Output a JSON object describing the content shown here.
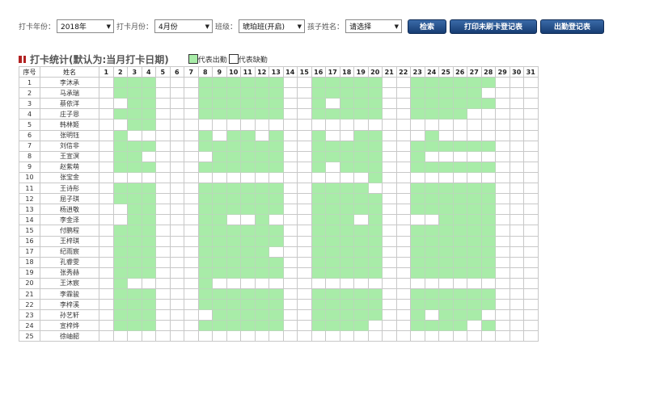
{
  "toolbar": {
    "year_label": "打卡年份：",
    "year_value": "2018年",
    "month_label": "打卡月份：",
    "month_value": "4月份",
    "class_label": "班级：",
    "class_value": "琥珀班(开启)",
    "child_label": "孩子姓名：",
    "child_value": "请选择",
    "search_label": "检索",
    "print_unswiped_label": "打印未刷卡登记表",
    "attendance_register_label": "出勤登记表"
  },
  "section": {
    "title": "打卡统计(默认为:当月打卡日期)",
    "legend_present": "代表出勤",
    "legend_absent": "代表缺勤"
  },
  "colors": {
    "present": "#a8eca8",
    "button": "#1f4a85",
    "title_marker": "#b22222"
  },
  "table": {
    "headers": {
      "index": "序号",
      "name": "姓名"
    },
    "days": [
      "1",
      "2",
      "3",
      "4",
      "5",
      "6",
      "7",
      "8",
      "9",
      "10",
      "11",
      "12",
      "13",
      "14",
      "15",
      "16",
      "17",
      "18",
      "19",
      "20",
      "21",
      "22",
      "23",
      "24",
      "25",
      "26",
      "27",
      "28",
      "29",
      "30",
      "31"
    ],
    "rows": [
      {
        "index": "1",
        "name": "李沐承",
        "present": [
          2,
          3,
          4,
          8,
          9,
          10,
          11,
          12,
          13,
          16,
          17,
          18,
          19,
          20,
          23,
          24,
          25,
          26,
          27,
          28
        ]
      },
      {
        "index": "2",
        "name": "马承瑞",
        "present": [
          2,
          3,
          4,
          8,
          9,
          10,
          11,
          12,
          13,
          16,
          17,
          18,
          19,
          20,
          23,
          24,
          25,
          26,
          27
        ]
      },
      {
        "index": "3",
        "name": "蔡依洋",
        "present": [
          3,
          4,
          8,
          9,
          10,
          11,
          12,
          13,
          16,
          18,
          19,
          20,
          23,
          24,
          25,
          26,
          27,
          28
        ]
      },
      {
        "index": "4",
        "name": "庄子恩",
        "present": [
          2,
          3,
          4,
          8,
          9,
          10,
          11,
          12,
          13,
          16,
          17,
          18,
          19,
          20,
          23,
          24,
          25,
          26
        ]
      },
      {
        "index": "5",
        "name": "韩林姬",
        "present": [
          3,
          4
        ]
      },
      {
        "index": "6",
        "name": "张明钰",
        "present": [
          2,
          8,
          10,
          11,
          13,
          16,
          19,
          20,
          24
        ]
      },
      {
        "index": "7",
        "name": "刘信非",
        "present": [
          2,
          3,
          4,
          8,
          9,
          10,
          11,
          12,
          13,
          16,
          17,
          18,
          19,
          20,
          23,
          24,
          25,
          26,
          27,
          28
        ]
      },
      {
        "index": "8",
        "name": "王宣溟",
        "present": [
          2,
          3,
          9,
          10,
          11,
          12,
          13,
          16,
          17,
          18,
          19,
          20,
          23
        ]
      },
      {
        "index": "9",
        "name": "赵紫萌",
        "present": [
          2,
          3,
          4,
          8,
          9,
          10,
          11,
          12,
          13,
          16,
          18,
          19,
          20,
          23,
          24,
          25,
          26,
          27,
          28
        ]
      },
      {
        "index": "10",
        "name": "张宝金",
        "present": [
          20
        ]
      },
      {
        "index": "11",
        "name": "王诗彤",
        "present": [
          2,
          3,
          4,
          8,
          9,
          10,
          11,
          12,
          13,
          16,
          17,
          18,
          19,
          23,
          24,
          25,
          26,
          27,
          28
        ]
      },
      {
        "index": "12",
        "name": "屈子琪",
        "present": [
          2,
          3,
          4,
          8,
          9,
          10,
          11,
          12,
          13,
          16,
          17,
          18,
          19,
          20,
          23,
          24,
          25,
          26,
          27,
          28
        ]
      },
      {
        "index": "13",
        "name": "杨逍敬",
        "present": [
          3,
          4,
          8,
          9,
          10,
          11,
          12,
          13,
          16,
          17,
          18,
          19,
          20,
          23,
          24,
          25,
          26,
          27,
          28
        ]
      },
      {
        "index": "14",
        "name": "李金泽",
        "present": [
          3,
          4,
          8,
          9,
          12,
          16,
          17,
          18,
          20,
          25,
          26,
          27,
          28
        ]
      },
      {
        "index": "15",
        "name": "付鹏程",
        "present": [
          2,
          3,
          4,
          8,
          9,
          10,
          11,
          12,
          13,
          16,
          17,
          18,
          19,
          20,
          23,
          24,
          25,
          26,
          27,
          28
        ]
      },
      {
        "index": "16",
        "name": "王梓琪",
        "present": [
          2,
          3,
          4,
          8,
          9,
          10,
          11,
          12,
          13,
          16,
          17,
          18,
          19,
          20,
          23,
          24,
          25,
          26,
          27,
          28
        ]
      },
      {
        "index": "17",
        "name": "纪雨宸",
        "present": [
          2,
          3,
          4,
          8,
          9,
          10,
          11,
          12,
          16,
          17,
          18,
          19,
          20,
          23,
          24,
          25,
          26,
          27,
          28
        ]
      },
      {
        "index": "18",
        "name": "孔睿雯",
        "present": [
          2,
          3,
          4,
          8,
          9,
          10,
          11,
          12,
          13,
          16,
          17,
          18,
          19,
          20,
          23,
          24,
          25,
          26,
          27,
          28
        ]
      },
      {
        "index": "19",
        "name": "张秀赫",
        "present": [
          2,
          3,
          4,
          8,
          9,
          10,
          11,
          12,
          13,
          16,
          17,
          18,
          19,
          20,
          23,
          24,
          25,
          26,
          27,
          28
        ]
      },
      {
        "index": "20",
        "name": "王沐宸",
        "present": [
          2,
          8
        ]
      },
      {
        "index": "21",
        "name": "李霖骏",
        "present": [
          2,
          3,
          4,
          8,
          9,
          10,
          11,
          12,
          13,
          16,
          17,
          18,
          19,
          20,
          23,
          24,
          25,
          26,
          27,
          28
        ]
      },
      {
        "index": "22",
        "name": "李梓溪",
        "present": [
          2,
          3,
          4,
          8,
          9,
          10,
          11,
          12,
          13,
          16,
          17,
          18,
          19,
          20,
          23,
          24,
          25,
          26,
          27,
          28
        ]
      },
      {
        "index": "23",
        "name": "孙艺轩",
        "present": [
          2,
          3,
          4,
          9,
          10,
          11,
          12,
          13,
          16,
          17,
          18,
          19,
          20,
          23,
          25,
          26,
          27
        ]
      },
      {
        "index": "24",
        "name": "宣梓烨",
        "present": [
          2,
          3,
          4,
          8,
          9,
          10,
          11,
          12,
          13,
          16,
          17,
          18,
          19,
          23,
          24,
          25,
          26,
          28
        ]
      },
      {
        "index": "25",
        "name": "徐岫韶",
        "present": []
      }
    ]
  }
}
